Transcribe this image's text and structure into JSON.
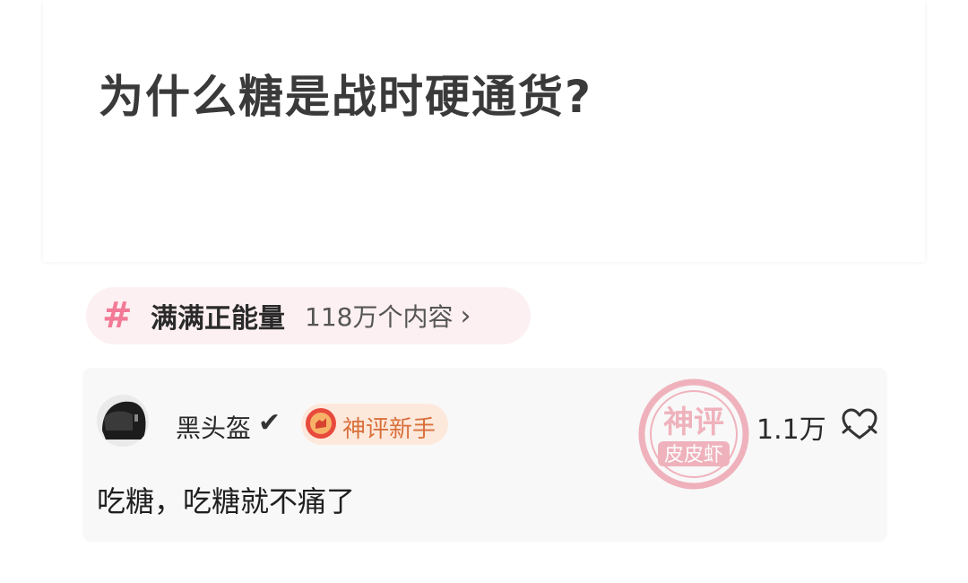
{
  "question": {
    "title": "为什么糖是战时硬通货?"
  },
  "topic": {
    "icon": "hash-icon",
    "name": "满满正能量",
    "count": "118万个内容",
    "chevron": "›"
  },
  "comment": {
    "avatar_icon": "helmet-avatar",
    "username": "黑头盔",
    "verified_icon": "✔",
    "badge": {
      "icon": "shield-medal-icon",
      "label": "神评新手"
    },
    "stamp": {
      "line1": "神评",
      "line2": "皮皮虾"
    },
    "like_count": "1.1万",
    "text": "吃糖，吃糖就不痛了"
  },
  "colors": {
    "accent_pink": "#f27a96",
    "badge_orange": "#d9703c",
    "stamp_red": "#e8788a"
  }
}
